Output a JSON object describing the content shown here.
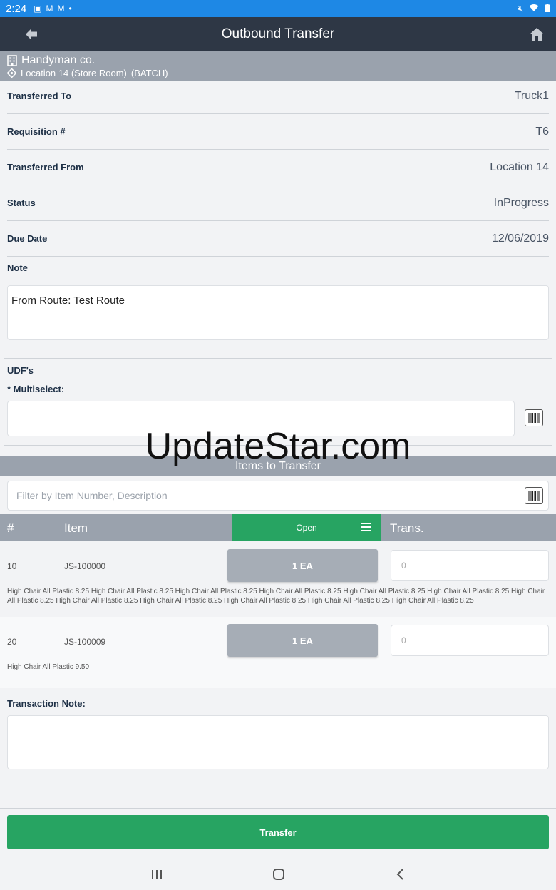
{
  "status_bar": {
    "time": "2:24",
    "left_icons": [
      "image-icon",
      "gmail-icon",
      "gmail-icon",
      "dot-icon"
    ],
    "right_icons": [
      "mute-icon",
      "wifi-icon",
      "battery-icon"
    ]
  },
  "app_bar": {
    "title": "Outbound Transfer"
  },
  "context": {
    "company": "Handyman co.",
    "location": "Location 14 (Store Room)",
    "mode": "(BATCH)"
  },
  "fields": [
    {
      "label": "Transferred To",
      "value": "Truck1"
    },
    {
      "label": "Requisition #",
      "value": "T6"
    },
    {
      "label": "Transferred From",
      "value": "Location 14"
    },
    {
      "label": "Status",
      "value": "InProgress"
    },
    {
      "label": "Due Date",
      "value": "12/06/2019"
    }
  ],
  "note": {
    "label": "Note",
    "value": "From Route: Test Route"
  },
  "udf": {
    "heading": "UDF's",
    "multiselect_label": "* Multiselect:",
    "multiselect_value": ""
  },
  "watermark": "UpdateStar.com",
  "items_section": {
    "title": "Items to Transfer",
    "filter_placeholder": "Filter by Item Number, Description",
    "columns": {
      "num": "#",
      "item": "Item",
      "open": "Open",
      "trans": "Trans."
    },
    "rows": [
      {
        "num": "10",
        "item": "JS-100000",
        "qty": "1 EA",
        "trans": "0",
        "desc": "High Chair All Plastic 8.25 High Chair All Plastic 8.25 High Chair All Plastic 8.25 High Chair All Plastic 8.25 High Chair All Plastic 8.25 High Chair All Plastic 8.25 High Chair All Plastic 8.25 High Chair All Plastic 8.25 High Chair All Plastic 8.25 High Chair All Plastic 8.25 High Chair All Plastic 8.25 High Chair All Plastic 8.25"
      },
      {
        "num": "20",
        "item": "JS-100009",
        "qty": "1 EA",
        "trans": "0",
        "desc": "High Chair All Plastic 9.50"
      }
    ]
  },
  "transaction_note": {
    "label": "Transaction Note:",
    "value": ""
  },
  "transfer_button": "Transfer",
  "colors": {
    "status_bar": "#1e88e5",
    "app_bar": "#2e3745",
    "header_gray": "#9aa2ad",
    "accent_green": "#27a462"
  }
}
